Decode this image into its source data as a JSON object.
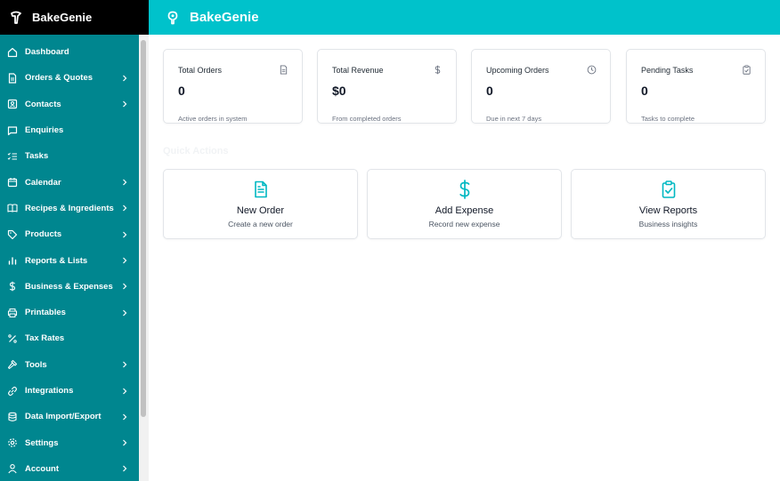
{
  "brand": {
    "name": "BakeGenie"
  },
  "topbar": {
    "title": "BakeGenie"
  },
  "colors": {
    "accent": "#00c2cb",
    "sidebar": "#00868f",
    "brand_bar": "#000000"
  },
  "sidebar": {
    "items": [
      {
        "label": "Dashboard",
        "icon": "home-icon",
        "has_submenu": false
      },
      {
        "label": "Orders & Quotes",
        "icon": "document-icon",
        "has_submenu": true
      },
      {
        "label": "Contacts",
        "icon": "contacts-icon",
        "has_submenu": true
      },
      {
        "label": "Enquiries",
        "icon": "chat-icon",
        "has_submenu": false
      },
      {
        "label": "Tasks",
        "icon": "checklist-icon",
        "has_submenu": false
      },
      {
        "label": "Calendar",
        "icon": "calendar-icon",
        "has_submenu": true
      },
      {
        "label": "Recipes & Ingredients",
        "icon": "book-icon",
        "has_submenu": true
      },
      {
        "label": "Products",
        "icon": "tag-icon",
        "has_submenu": true
      },
      {
        "label": "Reports & Lists",
        "icon": "bar-chart-icon",
        "has_submenu": true
      },
      {
        "label": "Business & Expenses",
        "icon": "dollar-icon",
        "has_submenu": true
      },
      {
        "label": "Printables",
        "icon": "printer-icon",
        "has_submenu": true
      },
      {
        "label": "Tax Rates",
        "icon": "percent-icon",
        "has_submenu": false
      },
      {
        "label": "Tools",
        "icon": "hammer-icon",
        "has_submenu": true
      },
      {
        "label": "Integrations",
        "icon": "link-icon",
        "has_submenu": true
      },
      {
        "label": "Data Import/Export",
        "icon": "database-icon",
        "has_submenu": true
      },
      {
        "label": "Settings",
        "icon": "gear-icon",
        "has_submenu": true
      },
      {
        "label": "Account",
        "icon": "user-icon",
        "has_submenu": true
      }
    ]
  },
  "stats": [
    {
      "title": "Total Orders",
      "value": "0",
      "sub": "Active orders in system",
      "icon": "file-icon"
    },
    {
      "title": "Total Revenue",
      "value": "$0",
      "sub": "From completed orders",
      "icon": "dollar-icon"
    },
    {
      "title": "Upcoming Orders",
      "value": "0",
      "sub": "Due in next 7 days",
      "icon": "clock-icon"
    },
    {
      "title": "Pending Tasks",
      "value": "0",
      "sub": "Tasks to complete",
      "icon": "clipboard-check-icon"
    }
  ],
  "quick_actions": {
    "title": "Quick Actions",
    "items": [
      {
        "label": "New Order",
        "sub": "Create a new order",
        "icon": "file-text-icon"
      },
      {
        "label": "Add Expense",
        "sub": "Record new expense",
        "icon": "dollar-icon"
      },
      {
        "label": "View Reports",
        "sub": "Business insights",
        "icon": "clipboard-check-icon"
      }
    ]
  }
}
